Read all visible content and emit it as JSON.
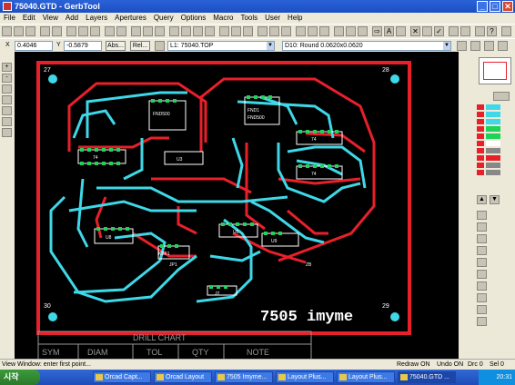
{
  "window": {
    "title": "75040.GTD - GerbTool"
  },
  "menu": [
    "File",
    "Edit",
    "View",
    "Add",
    "Layers",
    "Apertures",
    "Query",
    "Options",
    "Macro",
    "Tools",
    "User",
    "Help"
  ],
  "coords": {
    "x_label": "X",
    "x_value": "0.4046",
    "y_label": "Y",
    "y_value": "-0.5879",
    "abs_label": "Abs...",
    "rel_label": "Rel..."
  },
  "layer_combo": "L1: 75040.TOP",
  "aperture_combo": "D10: Round 0.0620x0.0620",
  "board": {
    "corner_labels": [
      "27",
      "28",
      "30",
      "29"
    ],
    "board_text": "7505 imyme",
    "drill_chart": "DRILL CHART",
    "drill_cols": [
      "SYM",
      "DIAM",
      "TOL",
      "QTY",
      "NOTE"
    ],
    "components": [
      "FND500",
      "FND1",
      "FND500",
      "74",
      "74",
      "74",
      "U3",
      "U5",
      "U8",
      "U9",
      "D1",
      "Q1",
      "Q2",
      "Q3",
      "KBF1",
      "JP1",
      "J2",
      "C1",
      "C2",
      "C3",
      "R1",
      "R2",
      "R3",
      "ZB"
    ]
  },
  "status": {
    "message": "View Window: enter first point...",
    "redraw": "Redraw ON",
    "undo": "Undo ON",
    "drc": "Drc 0",
    "sel": "Sel 0"
  },
  "taskbar": {
    "start": "시작",
    "tasks": [
      "Orcad Capt...",
      "Orcad Layout",
      "7505 Imyme...",
      "Layout Plus...",
      "Layout Plus...",
      "75040.GTD ..."
    ],
    "clock": "20:31"
  },
  "colors": {
    "board_red": "#e8202a",
    "trace_cyan": "#3ed8e8",
    "silk_white": "#ffffff",
    "pad_green": "#1ed35a"
  }
}
